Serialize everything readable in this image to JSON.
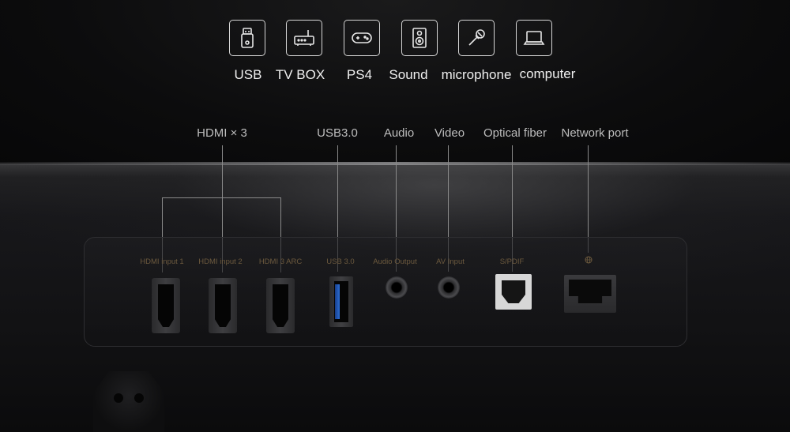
{
  "devices": [
    {
      "label": "USB",
      "icon": "usb-drive-icon"
    },
    {
      "label": "TV BOX",
      "icon": "tv-box-icon"
    },
    {
      "label": "PS4",
      "icon": "gamepad-icon"
    },
    {
      "label": "Sound",
      "icon": "speaker-icon"
    },
    {
      "label": "microphone",
      "icon": "microphone-icon"
    },
    {
      "label": "computer",
      "icon": "laptop-icon"
    }
  ],
  "port_headers": {
    "hdmi": "HDMI × 3",
    "usb": "USB3.0",
    "audio": "Audio",
    "video": "Video",
    "optical": "Optical fiber",
    "network": "Network port"
  },
  "port_labels": {
    "hdmi1": "HDMI input 1",
    "hdmi2": "HDMI input 2",
    "hdmi3": "HDMI 3 ARC",
    "usb": "USB 3.0",
    "audio_out": "Audio Output",
    "av_in": "AV Input",
    "spdif": "S/PDIF"
  },
  "colors": {
    "background": "#0b0b0c",
    "icon_stroke": "#d6d6d6",
    "port_label": "#6d5a3e",
    "usb_blue": "#2d6fd6"
  }
}
